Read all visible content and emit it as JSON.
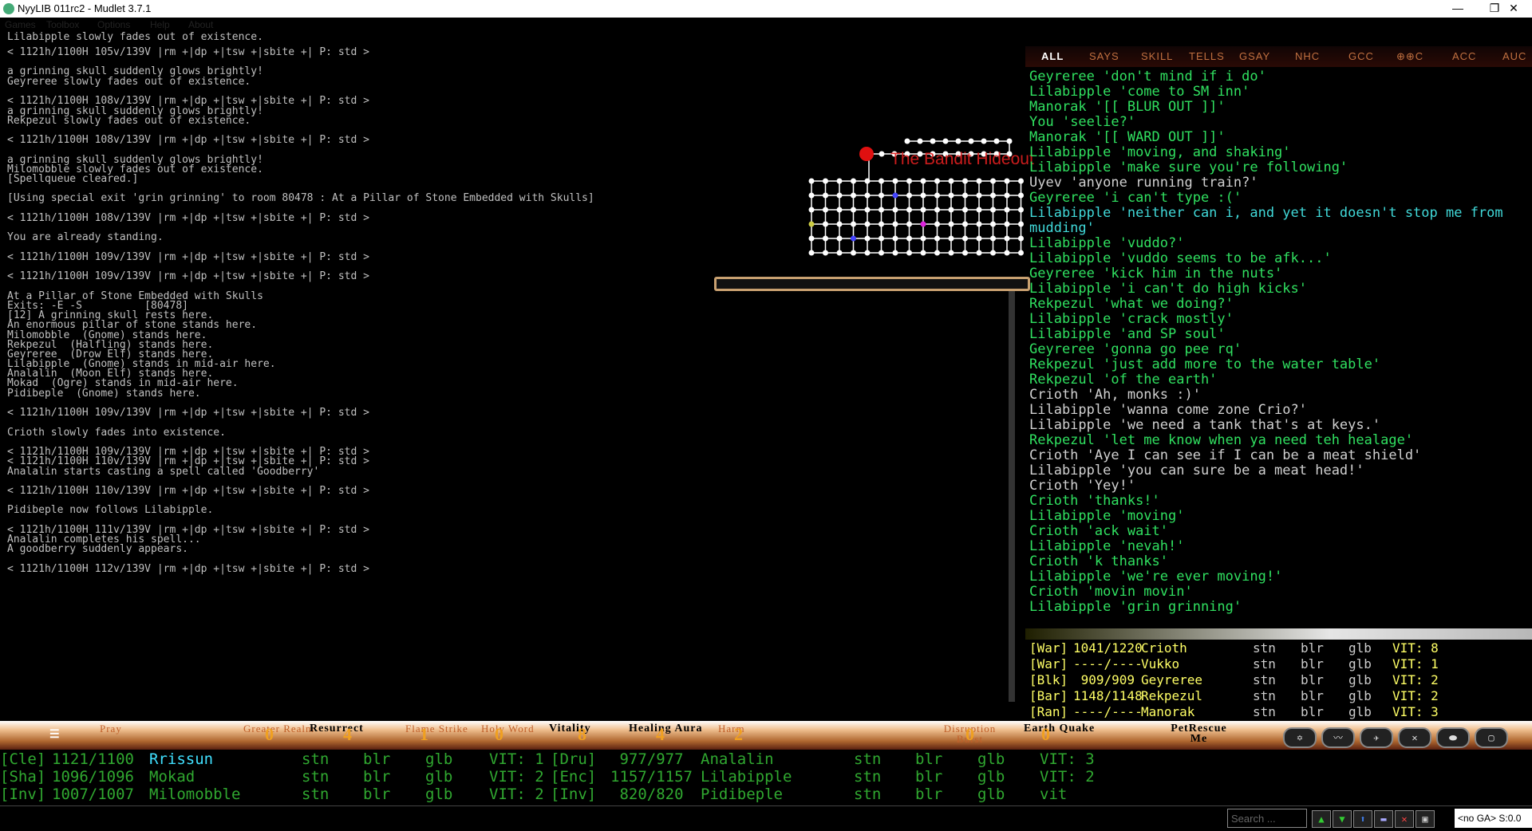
{
  "window": {
    "title": "NyyLIB 011rc2 - Mudlet 3.7.1",
    "minimize": "—",
    "maximize": "❐",
    "close": "✕"
  },
  "menu": [
    "Games",
    "Toolbox",
    "Options",
    "Help",
    "About"
  ],
  "main_lines": [
    {
      "t": "Lilabipple slowly fades out of existence.",
      "c": "c-white"
    },
    {
      "t": "< 1121h/1100H 105v/139V |rm +|dp +|tsw +|sbite +| P: std >",
      "c": "c-prompt"
    },
    {
      "t": "a grinning skull suddenly glows brightly!",
      "c": "c-white"
    },
    {
      "t": "Geyreree slowly fades out of existence.",
      "c": "c-gray"
    },
    {
      "t": "< 1121h/1100H 108v/139V |rm +|dp +|tsw +|sbite +| P: std >",
      "c": "c-prompt"
    },
    {
      "t": "a grinning skull suddenly glows brightly!",
      "c": "c-white"
    },
    {
      "t": "Rekpezul slowly fades out of existence.",
      "c": "c-gray"
    },
    {
      "t": "< 1121h/1100H 108v/139V |rm +|dp +|tsw +|sbite +| P: std >",
      "c": "c-prompt"
    },
    {
      "t": "a grinning skull suddenly glows brightly!",
      "c": "c-white"
    },
    {
      "t": "Milomobble slowly fades out of existence.",
      "c": "c-gray"
    },
    {
      "t": "[Spellqueue cleared.]",
      "c": "c-blue"
    },
    {
      "t": "[Using special exit 'grin grinning' to room 80478 : At a Pillar of Stone Embedded with Skulls]",
      "c": "c-green"
    },
    {
      "t": "< 1121h/1100H 108v/139V |rm +|dp +|tsw +|sbite +| P: std >",
      "c": "c-prompt"
    },
    {
      "t": "You are already standing.",
      "c": "c-white"
    },
    {
      "t": "< 1121h/1100H 109v/139V |rm +|dp +|tsw +|sbite +| P: std >",
      "c": "c-prompt"
    },
    {
      "t": "< 1121h/1100H 109v/139V |rm +|dp +|tsw +|sbite +| P: std >",
      "c": "c-prompt"
    },
    {
      "t": "At a Pillar of Stone Embedded with Skulls",
      "c": "c-white"
    },
    {
      "t": "Exits: -E -S          [80478]",
      "c": "c-teal"
    },
    {
      "t": "[12] A grinning skull rests here.",
      "c": "c-white"
    },
    {
      "t": "An enormous pillar of stone stands here.",
      "c": "c-white"
    },
    {
      "t": "Milomobble  (Gnome) stands here.",
      "c": "c-white"
    },
    {
      "t": "Rekpezul  (Halfling) stands here.",
      "c": "c-white"
    },
    {
      "t": "Geyreree  (Drow Elf) stands here.",
      "c": "c-white"
    },
    {
      "t": "Lilabipple  (Gnome) stands in mid-air here.",
      "c": "c-white"
    },
    {
      "t": "Analalin  (Moon Elf) stands here.",
      "c": "c-white"
    },
    {
      "t": "Mokad  (Ogre) stands in mid-air here.",
      "c": "c-white"
    },
    {
      "t": "Pidibeple  (Gnome) stands here.",
      "c": "c-white"
    },
    {
      "t": "< 1121h/1100H 109v/139V |rm +|dp +|tsw +|sbite +| P: std >",
      "c": "c-prompt"
    },
    {
      "t": "Crioth slowly fades into existence.",
      "c": "c-white"
    },
    {
      "t": "< 1121h/1100H 109v/139V |rm +|dp +|tsw +|sbite +| P: std >",
      "c": "c-prompt"
    },
    {
      "t": "< 1121h/1100H 110v/139V |rm +|dp +|tsw +|sbite +| P: std >",
      "c": "c-prompt"
    },
    {
      "t": "Analalin starts casting a spell called 'Goodberry'",
      "c": "c-cyan"
    },
    {
      "t": "< 1121h/1100H 110v/139V |rm +|dp +|tsw +|sbite +| P: std >",
      "c": "c-prompt"
    },
    {
      "t": "Pidibeple now follows Lilabipple.",
      "c": "c-white"
    },
    {
      "t": "< 1121h/1100H 111v/139V |rm +|dp +|tsw +|sbite +| P: std >",
      "c": "c-prompt"
    },
    {
      "t": "Analalin completes his spell...",
      "c": "c-white"
    },
    {
      "t": "A goodberry suddenly appears.",
      "c": "c-white"
    },
    {
      "t": "< 1121h/1100H 112v/139V |rm +|dp +|tsw +|sbite +| P: std >",
      "c": "c-prompt"
    }
  ],
  "map": {
    "area_title": "The Bandit Hideout"
  },
  "chat_tabs": [
    "ALL",
    "SAYS",
    "SKILL",
    "TELLS",
    "GSAY",
    "NHC",
    "GCC",
    "⊕⊕C",
    "ACC",
    "AUC"
  ],
  "chat": [
    {
      "name": "Geyreree",
      "text": " 'don't mind if i do'",
      "c": ""
    },
    {
      "name": "Lilabipple",
      "text": " 'come to SM inn'",
      "c": ""
    },
    {
      "name": "Manorak",
      "text": " '[[ BLUR OUT ]]'",
      "c": ""
    },
    {
      "name": "You",
      "text": " 'seelie?'",
      "c": ""
    },
    {
      "name": "Manorak",
      "text": " '[[ WARD OUT ]]'",
      "c": ""
    },
    {
      "name": "Lilabipple",
      "text": " 'moving, and shaking'",
      "c": ""
    },
    {
      "name": "Lilabipple",
      "text": " 'make sure you're following'",
      "c": ""
    },
    {
      "name": "Uyev",
      "text": " 'anyone running train?'",
      "c": "white"
    },
    {
      "name": "Geyreree",
      "text": " 'i can't type :('",
      "c": ""
    },
    {
      "name": "Lilabipple",
      "text": " 'neither can i, and yet it doesn't stop me from",
      "c": "cyan"
    },
    {
      "name": "mudding'",
      "text": "",
      "c": "cyan"
    },
    {
      "name": "Lilabipple",
      "text": " 'vuddo?'",
      "c": ""
    },
    {
      "name": "Lilabipple",
      "text": " 'vuddo seems to be afk...'",
      "c": ""
    },
    {
      "name": "Geyreree",
      "text": " 'kick him in the nuts'",
      "c": ""
    },
    {
      "name": "Lilabipple",
      "text": " 'i can't do high kicks'",
      "c": ""
    },
    {
      "name": "Rekpezul",
      "text": " 'what we doing?'",
      "c": ""
    },
    {
      "name": "Lilabipple",
      "text": " 'crack mostly'",
      "c": ""
    },
    {
      "name": "Lilabipple",
      "text": " 'and SP soul'",
      "c": ""
    },
    {
      "name": "Geyreree",
      "text": " 'gonna go pee rq'",
      "c": ""
    },
    {
      "name": "Rekpezul",
      "text": " 'just add more to the water table'",
      "c": ""
    },
    {
      "name": "Rekpezul",
      "text": " 'of the earth'",
      "c": ""
    },
    {
      "name": "Crioth",
      "text": " 'Ah, monks :)'",
      "c": "white"
    },
    {
      "name": "Lilabipple",
      "text": " 'wanna come zone Crio?'",
      "c": "white"
    },
    {
      "name": "Lilabipple",
      "text": " 'we need a tank that's at keys.'",
      "c": "white"
    },
    {
      "name": "Rekpezul",
      "text": " 'let me know when ya need teh healage'",
      "c": ""
    },
    {
      "name": "Crioth",
      "text": " 'Aye I can see if I can be a meat shield'",
      "c": "white"
    },
    {
      "name": "Lilabipple",
      "text": " 'you can sure be a meat head!'",
      "c": "white"
    },
    {
      "name": "Crioth",
      "text": " 'Yey!'",
      "c": "white"
    },
    {
      "name": "Crioth",
      "text": " 'thanks!'",
      "c": ""
    },
    {
      "name": "Lilabipple",
      "text": " 'moving'",
      "c": ""
    },
    {
      "name": "Crioth",
      "text": " 'ack wait'",
      "c": ""
    },
    {
      "name": "Lilabipple",
      "text": " 'nevah!'",
      "c": ""
    },
    {
      "name": "Crioth",
      "text": " 'k thanks'",
      "c": ""
    },
    {
      "name": "Lilabipple",
      "text": " 'we're ever moving!'",
      "c": ""
    },
    {
      "name": "Crioth",
      "text": " 'movin movin'",
      "c": ""
    },
    {
      "name": "Lilabipple",
      "text": " 'grin grinning'",
      "c": ""
    }
  ],
  "group": [
    {
      "cls": "[War]",
      "hp": "1041/1220",
      "name": "Crioth",
      "a": "stn",
      "b": "blr",
      "c": "glb",
      "vit": "VIT: 8"
    },
    {
      "cls": "[War]",
      "hp": "----/----",
      "name": "Vukko",
      "a": "stn",
      "b": "blr",
      "c": "glb",
      "vit": "VIT: 1"
    },
    {
      "cls": "[Blk]",
      "hp": " 909/909 ",
      "name": "Geyreree",
      "a": "stn",
      "b": "blr",
      "c": "glb",
      "vit": "VIT: 2"
    },
    {
      "cls": "[Bar]",
      "hp": "1148/1148",
      "name": "Rekpezul",
      "a": "stn",
      "b": "blr",
      "c": "glb",
      "vit": "VIT: 2"
    },
    {
      "cls": "[Ran]",
      "hp": "----/----",
      "name": "Manorak",
      "a": "stn",
      "b": "blr",
      "c": "glb",
      "vit": "VIT: 3"
    }
  ],
  "skills": [
    {
      "label": "Pray",
      "count": ""
    },
    {
      "label": "Greater Realm",
      "count": "0"
    },
    {
      "label": "Resurrect",
      "count": "4",
      "bold": true
    },
    {
      "label": "Flame Strike",
      "count": "1"
    },
    {
      "label": "Holy Word",
      "count": "0"
    },
    {
      "label": "Vitality",
      "count": "8",
      "bold": true
    },
    {
      "label": "Healing Aura",
      "count": "4",
      "bold": true
    },
    {
      "label": "Harm",
      "count": "2"
    },
    {
      "label": "Disruption Burst",
      "count": "0"
    },
    {
      "label": "Earth Quake",
      "count": "0",
      "bold": true
    },
    {
      "label": "PetRescue Me",
      "count": "",
      "bold": true
    }
  ],
  "party_left": [
    {
      "cls": "[Cle]",
      "hp": "1121/1100",
      "name": "Rrissun",
      "a": "stn",
      "b": "blr",
      "c": "glb",
      "vit": "VIT: 1"
    },
    {
      "cls": "[Sha]",
      "hp": "1096/1096",
      "name": "Mokad",
      "a": "stn",
      "b": "blr",
      "c": "glb",
      "vit": "VIT: 2"
    },
    {
      "cls": "[Inv]",
      "hp": "1007/1007",
      "name": "Milomobble",
      "a": "stn",
      "b": "blr",
      "c": "glb",
      "vit": "VIT: 2"
    }
  ],
  "party_right": [
    {
      "cls": "[Dru]",
      "hp": " 977/977 ",
      "name": "Analalin",
      "a": "stn",
      "b": "blr",
      "c": "glb",
      "vit": "VIT: 3"
    },
    {
      "cls": "[Enc]",
      "hp": "1157/1157",
      "name": "Lilabipple",
      "a": "stn",
      "b": "blr",
      "c": "glb",
      "vit": "VIT: 2"
    },
    {
      "cls": "[Inv]",
      "hp": " 820/820 ",
      "name": "Pidibeple",
      "a": "stn",
      "b": "blr",
      "c": "glb",
      "vit": "vit"
    }
  ],
  "status": {
    "search_placeholder": "Search ...",
    "ga": "<no GA> S:0.0"
  }
}
